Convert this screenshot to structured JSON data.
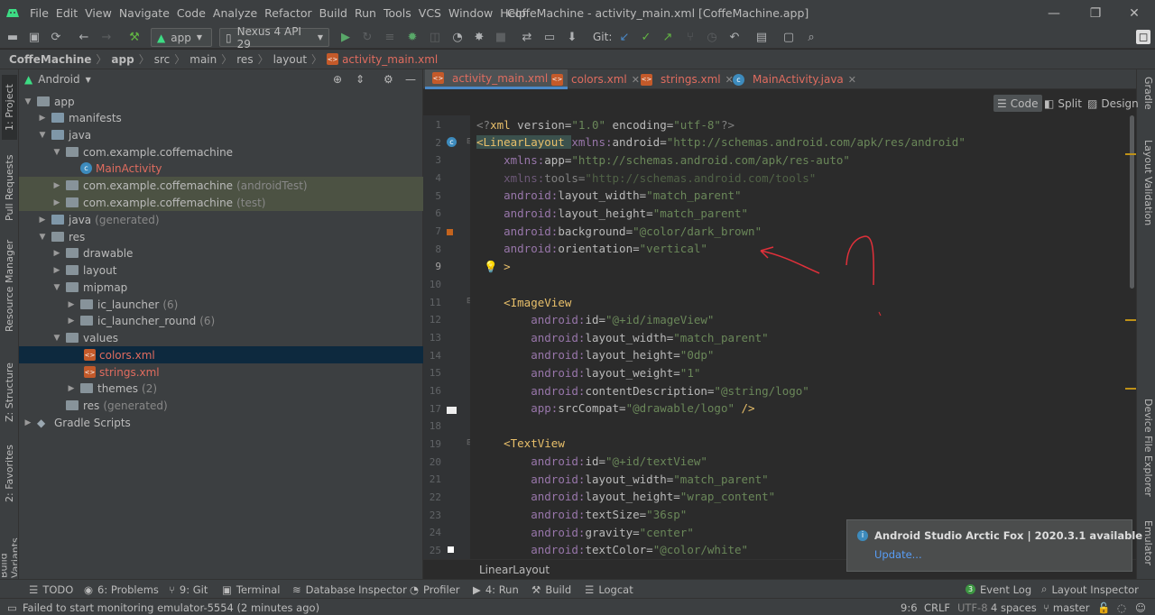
{
  "menubar": {
    "items": [
      "File",
      "Edit",
      "View",
      "Navigate",
      "Code",
      "Analyze",
      "Refactor",
      "Build",
      "Run",
      "Tools",
      "VCS",
      "Window",
      "Help"
    ],
    "title": "CoffeMachine - activity_main.xml [CoffeMachine.app]"
  },
  "toolbar": {
    "run_config": "app",
    "device": "Nexus 4 API 29",
    "git_label": "Git:"
  },
  "breadcrumb": [
    "CoffeMachine",
    "app",
    "src",
    "main",
    "res",
    "layout",
    "activity_main.xml"
  ],
  "left_tabs": [
    "1: Project",
    "Pull Requests",
    "Resource Manager",
    "Z: Structure",
    "2: Favorites",
    "Build Variants"
  ],
  "right_tabs": [
    "Gradle",
    "Layout Validation",
    "Device File Explorer",
    "Emulator"
  ],
  "project": {
    "view_mode": "Android",
    "tree": [
      {
        "label": "app",
        "hint": ""
      },
      {
        "label": "manifests",
        "hint": ""
      },
      {
        "label": "java",
        "hint": ""
      },
      {
        "label": "com.example.coffemachine",
        "hint": ""
      },
      {
        "label": "MainActivity",
        "hint": ""
      },
      {
        "label": "com.example.coffemachine",
        "hint": "(androidTest)"
      },
      {
        "label": "com.example.coffemachine",
        "hint": "(test)"
      },
      {
        "label": "java",
        "hint": "(generated)"
      },
      {
        "label": "res",
        "hint": ""
      },
      {
        "label": "drawable",
        "hint": ""
      },
      {
        "label": "layout",
        "hint": ""
      },
      {
        "label": "mipmap",
        "hint": ""
      },
      {
        "label": "ic_launcher",
        "hint": "(6)"
      },
      {
        "label": "ic_launcher_round",
        "hint": "(6)"
      },
      {
        "label": "values",
        "hint": ""
      },
      {
        "label": "colors.xml",
        "hint": ""
      },
      {
        "label": "strings.xml",
        "hint": ""
      },
      {
        "label": "themes",
        "hint": "(2)"
      },
      {
        "label": "res",
        "hint": "(generated)"
      },
      {
        "label": "Gradle Scripts",
        "hint": ""
      }
    ]
  },
  "editor": {
    "tabs": [
      "activity_main.xml",
      "colors.xml",
      "strings.xml",
      "MainActivity.java"
    ],
    "view_modes": [
      "Code",
      "Split",
      "Design"
    ],
    "warnings": "3",
    "weak_warnings": "1",
    "line_numbers": [
      "1",
      "2",
      "3",
      "4",
      "5",
      "6",
      "7",
      "8",
      "9",
      "10",
      "11",
      "12",
      "13",
      "14",
      "15",
      "16",
      "17",
      "18",
      "19",
      "20",
      "21",
      "22",
      "23",
      "24",
      "25"
    ],
    "lines": [
      "<?xml version=\"1.0\" encoding=\"utf-8\"?>",
      "<LinearLayout xmlns:android=\"http://schemas.android.com/apk/res/android\"",
      "    xmlns:app=\"http://schemas.android.com/apk/res-auto\"",
      "    xmlns:tools=\"http://schemas.android.com/tools\"",
      "    android:layout_width=\"match_parent\"",
      "    android:layout_height=\"match_parent\"",
      "    android:background=\"@color/dark_brown\"",
      "    android:orientation=\"vertical\"",
      "    >",
      "",
      "    <ImageView",
      "        android:id=\"@+id/imageView\"",
      "        android:layout_width=\"match_parent\"",
      "        android:layout_height=\"0dp\"",
      "        android:layout_weight=\"1\"",
      "        android:contentDescription=\"@string/logo\"",
      "        app:srcCompat=\"@drawable/logo\" />",
      "",
      "    <TextView",
      "        android:id=\"@+id/textView\"",
      "        android:layout_width=\"match_parent\"",
      "        android:layout_height=\"wrap_content\"",
      "        android:textSize=\"36sp\"",
      "        android:gravity=\"center\"",
      "        android:textColor=\"@color/white\""
    ],
    "structure_breadcrumb": "LinearLayout"
  },
  "notification": {
    "title": "Android Studio Arctic Fox | 2020.3.1 available",
    "action": "Update..."
  },
  "bottom_tabs": [
    "TODO",
    "6: Problems",
    "9: Git",
    "Terminal",
    "Database Inspector",
    "Profiler",
    "4: Run",
    "Build",
    "Logcat",
    "Event Log",
    "Layout Inspector"
  ],
  "status": {
    "message": "Failed to start monitoring emulator-5554 (2 minutes ago)",
    "position": "9:6",
    "line_sep": "CRLF",
    "encoding": "UTF-8",
    "indent": "4 spaces",
    "branch": "master"
  }
}
